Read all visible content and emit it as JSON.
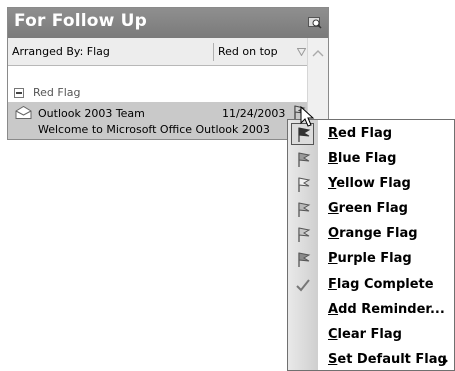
{
  "pane": {
    "title": "For Follow Up",
    "header_icon": "search-folder-icon",
    "arrange_by": "Arranged By: Flag",
    "sort_order": "Red on top"
  },
  "group": {
    "label": "Red Flag",
    "toggle_icon": "collapse-minus-icon"
  },
  "mail_item": {
    "sender": "Outlook 2003 Team",
    "date": "11/24/2003",
    "subject": "Welcome to Microsoft Office Outlook 2003",
    "icon": "envelope-open-icon"
  },
  "context_menu": {
    "items": [
      {
        "label": "Red Flag",
        "icon": "flag-icon",
        "selected": true
      },
      {
        "label": "Blue Flag",
        "icon": "flag-icon"
      },
      {
        "label": "Yellow Flag",
        "icon": "flag-icon"
      },
      {
        "label": "Green Flag",
        "icon": "flag-icon"
      },
      {
        "label": "Orange Flag",
        "icon": "flag-icon"
      },
      {
        "label": "Purple Flag",
        "icon": "flag-icon"
      },
      {
        "label": "Flag Complete",
        "icon": "checkmark-icon"
      },
      {
        "label": "Add Reminder...",
        "icon": ""
      },
      {
        "label": "Clear Flag",
        "icon": ""
      },
      {
        "label": "Set Default Flag",
        "icon": "submenu-arrow-icon"
      }
    ]
  },
  "colors": {
    "header_bg": "#858585",
    "selected_row": "#c9c9c9",
    "menu_gutter": "#dcdcdc"
  }
}
